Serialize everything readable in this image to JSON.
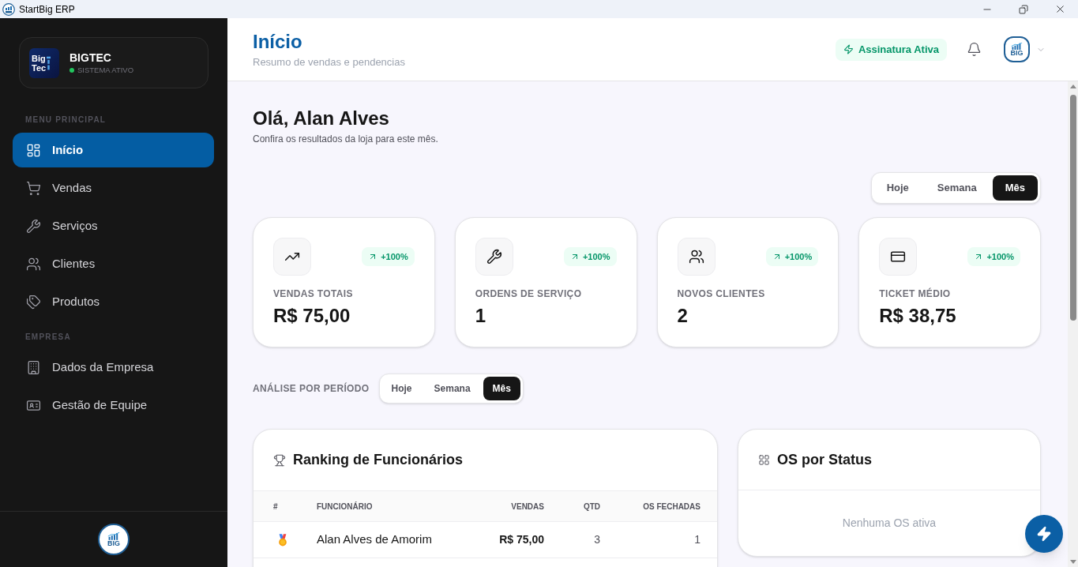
{
  "window": {
    "title": "StartBig ERP"
  },
  "sidebar": {
    "company": {
      "logo_text": [
        "Big",
        "Tec"
      ],
      "name": "BIGTEC",
      "status": "SISTEMA ATIVO"
    },
    "sections": [
      {
        "title": "MENU PRINCIPAL",
        "items": [
          {
            "label": "Início",
            "selected": true
          },
          {
            "label": "Vendas",
            "selected": false
          },
          {
            "label": "Serviços",
            "selected": false
          },
          {
            "label": "Clientes",
            "selected": false
          },
          {
            "label": "Produtos",
            "selected": false
          }
        ]
      },
      {
        "title": "EMPRESA",
        "items": [
          {
            "label": "Dados da Empresa",
            "selected": false
          },
          {
            "label": "Gestão de Equipe",
            "selected": false
          }
        ]
      }
    ],
    "footer_logo_text": "BIG"
  },
  "header": {
    "title": "Início",
    "subtitle": "Resumo de vendas e pendencias",
    "subscription_badge": "Assinatura Ativa",
    "avatar_text": "BIG"
  },
  "greeting": {
    "title": "Olá, Alan Alves",
    "subtitle": "Confira os resultados da loja para este mês."
  },
  "period_tabs": [
    {
      "label": "Hoje",
      "selected": false
    },
    {
      "label": "Semana",
      "selected": false
    },
    {
      "label": "Mês",
      "selected": true
    }
  ],
  "stat_cards": [
    {
      "label": "VENDAS TOTAIS",
      "value": "R$ 75,00",
      "change": "+100%"
    },
    {
      "label": "ORDENS DE SERVIÇO",
      "value": "1",
      "change": "+100%"
    },
    {
      "label": "NOVOS CLIENTES",
      "value": "2",
      "change": "+100%"
    },
    {
      "label": "TICKET MÉDIO",
      "value": "R$ 38,75",
      "change": "+100%"
    }
  ],
  "analysis": {
    "label": "ANÁLISE POR PERÍODO",
    "tabs": [
      {
        "label": "Hoje",
        "selected": false
      },
      {
        "label": "Semana",
        "selected": false
      },
      {
        "label": "Mês",
        "selected": true
      }
    ]
  },
  "ranking": {
    "title": "Ranking de Funcionários",
    "columns": [
      "#",
      "FUNCIONÁRIO",
      "VENDAS",
      "QTD",
      "OS FECHADAS"
    ],
    "rows": [
      {
        "name": "Alan Alves de Amorim",
        "sales": "R$ 75,00",
        "qty": "3",
        "closed_os": "1"
      }
    ]
  },
  "os_status": {
    "title": "OS por Status",
    "empty_text": "Nenhuma OS ativa"
  }
}
